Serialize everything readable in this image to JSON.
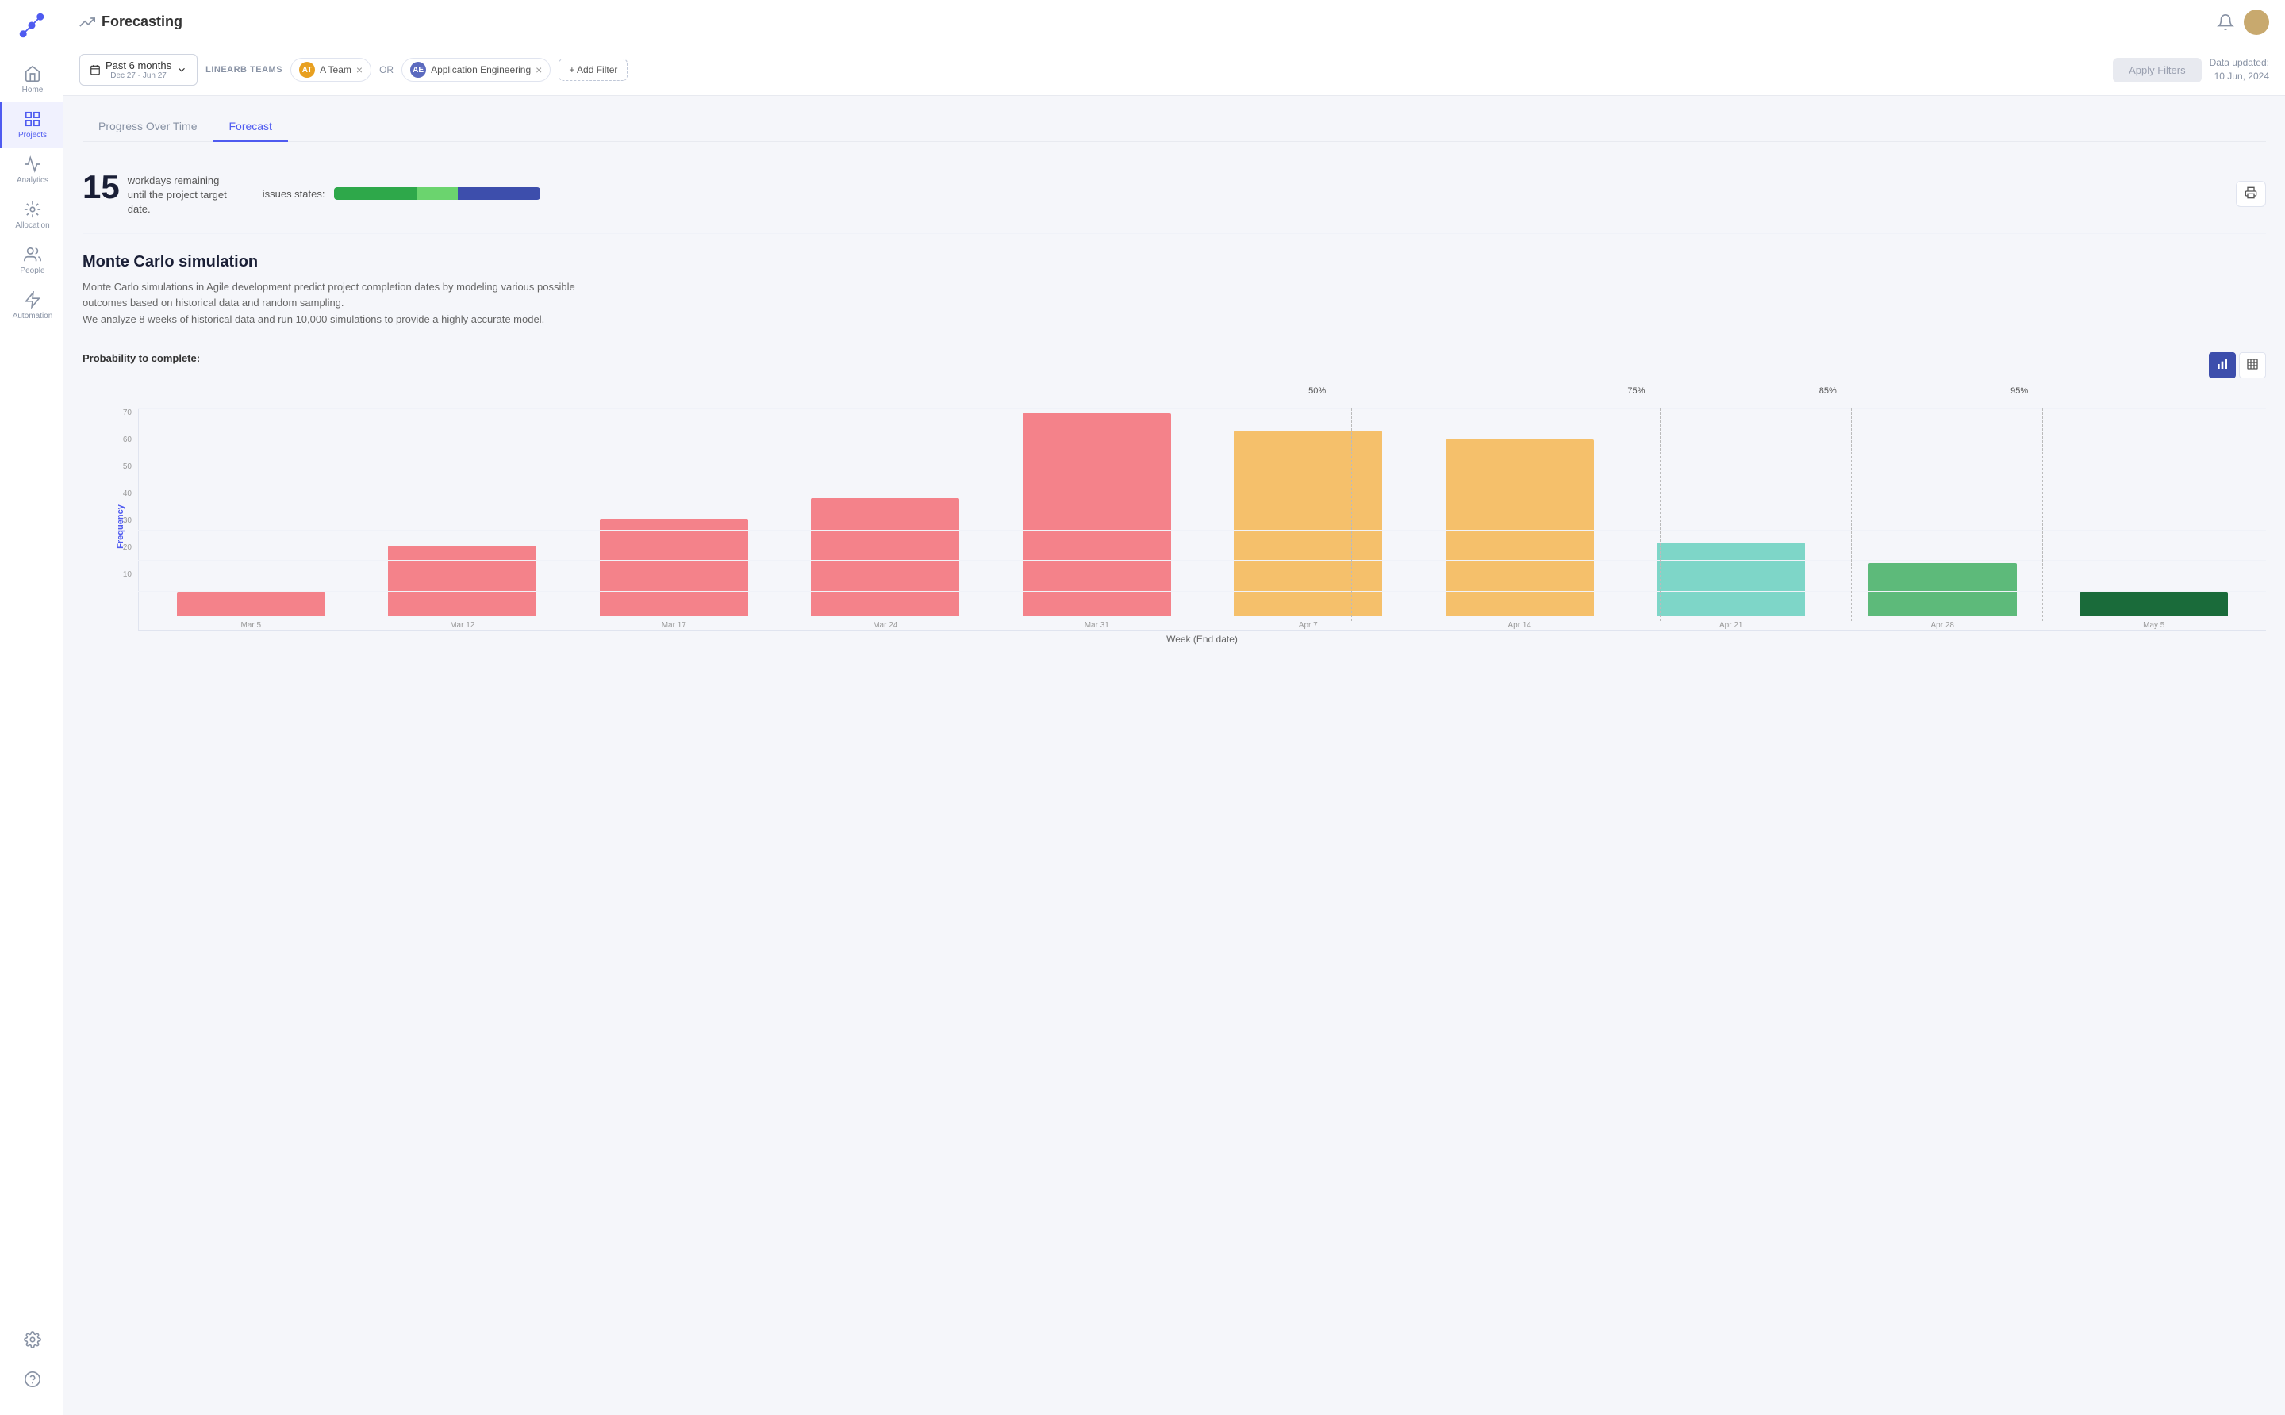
{
  "app": {
    "logo_alt": "LinearB logo"
  },
  "header": {
    "title": "Forecasting",
    "trend_icon": "trend-up-icon",
    "data_updated_label": "Data updated:",
    "data_updated_date": "10 Jun, 2024"
  },
  "sidebar": {
    "nav_items": [
      {
        "id": "home",
        "label": "Home",
        "active": false
      },
      {
        "id": "projects",
        "label": "Projects",
        "active": true
      },
      {
        "id": "analytics",
        "label": "Analytics",
        "active": false
      },
      {
        "id": "allocation",
        "label": "Allocation",
        "active": false
      },
      {
        "id": "people",
        "label": "People",
        "active": false
      },
      {
        "id": "automation",
        "label": "Automation",
        "active": false
      }
    ],
    "bottom_items": [
      {
        "id": "settings",
        "label": "Settings"
      },
      {
        "id": "help",
        "label": "Help"
      }
    ]
  },
  "filters": {
    "date_range": {
      "label": "Past 6 months",
      "sub_label": "Dec 27 - Jun 27"
    },
    "teams_label": "LINEARB TEAMS",
    "chips": [
      {
        "id": "a-team",
        "label": "A Team",
        "color": "#e8a020",
        "initials": "AT"
      },
      {
        "id": "app-eng",
        "label": "Application Engineering",
        "color": "#5b6abf",
        "initials": "AE"
      }
    ],
    "or_label": "OR",
    "add_filter_label": "+ Add Filter",
    "apply_label": "Apply Filters"
  },
  "tabs": [
    {
      "id": "progress",
      "label": "Progress Over Time",
      "active": false
    },
    {
      "id": "forecast",
      "label": "Forecast",
      "active": true
    }
  ],
  "workdays": {
    "count": "15",
    "description": "workdays remaining until the project target date.",
    "issues_label": "issues states:"
  },
  "monte_carlo": {
    "title": "Monte Carlo simulation",
    "description_line1": "Monte Carlo simulations in Agile development predict project completion dates by modeling various possible",
    "description_line2": "outcomes based on historical data and random sampling.",
    "description_line3": "We analyze 8 weeks of historical data and run 10,000 simulations to provide a highly accurate model."
  },
  "chart": {
    "probability_label": "Probability to complete:",
    "y_axis_title": "Frequency",
    "x_axis_title": "Week (End date)",
    "y_labels": [
      "10",
      "20",
      "30",
      "40",
      "50",
      "60",
      "70"
    ],
    "bars": [
      {
        "week": "Mar 5",
        "value": 8,
        "color": "#f4828a"
      },
      {
        "week": "Mar 12",
        "value": 24,
        "color": "#f4828a"
      },
      {
        "week": "Mar 17",
        "value": 33,
        "color": "#f4828a"
      },
      {
        "week": "Mar 24",
        "value": 40,
        "color": "#f4828a"
      },
      {
        "week": "Mar 31",
        "value": 69,
        "color": "#f4828a"
      },
      {
        "week": "Apr 7",
        "value": 63,
        "color": "#f5c06b"
      },
      {
        "week": "Apr 14",
        "value": 60,
        "color": "#f5c06b"
      },
      {
        "week": "Apr 21",
        "value": 25,
        "color": "#7ed6c8"
      },
      {
        "week": "Apr 28",
        "value": 18,
        "color": "#5dba7a"
      },
      {
        "week": "May 5",
        "value": 8,
        "color": "#1a6b3a"
      }
    ],
    "prob_markers": [
      {
        "label": "50%",
        "position_pct": 56
      },
      {
        "label": "75%",
        "position_pct": 71
      },
      {
        "label": "85%",
        "position_pct": 80
      },
      {
        "label": "95%",
        "position_pct": 89
      }
    ],
    "progress_segments": [
      {
        "color": "#2ea84a",
        "width": 40
      },
      {
        "color": "#6bd46e",
        "width": 20
      },
      {
        "color": "#3d4eac",
        "width": 40
      }
    ]
  }
}
